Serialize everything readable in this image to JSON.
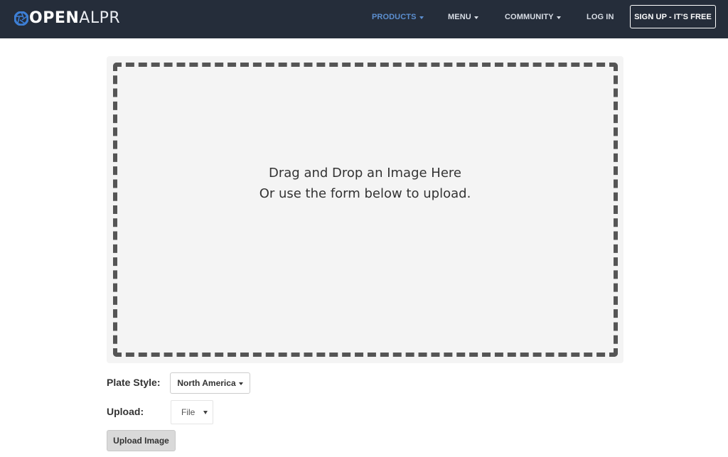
{
  "nav": {
    "logo": {
      "part_bold": "OPEN",
      "part_light": "ALPR"
    },
    "items": [
      {
        "label": "PRODUCTS",
        "active": true,
        "has_dropdown": true
      },
      {
        "label": "MENU",
        "active": false,
        "has_dropdown": true
      },
      {
        "label": "COMMUNITY",
        "active": false,
        "has_dropdown": true
      },
      {
        "label": "LOG IN",
        "active": false,
        "has_dropdown": false
      }
    ],
    "signup_label": "SIGN UP - IT'S FREE",
    "colors": {
      "background": "#252d3a",
      "active": "#5c8fd0",
      "text": "#d8dde5"
    }
  },
  "dropzone": {
    "line1": "Drag and Drop an Image Here",
    "line2": "Or use the form below to upload."
  },
  "form": {
    "plate_style": {
      "label": "Plate Style:",
      "selected": "North America"
    },
    "upload": {
      "label": "Upload:",
      "selected": "File"
    },
    "submit_label": "Upload Image"
  }
}
